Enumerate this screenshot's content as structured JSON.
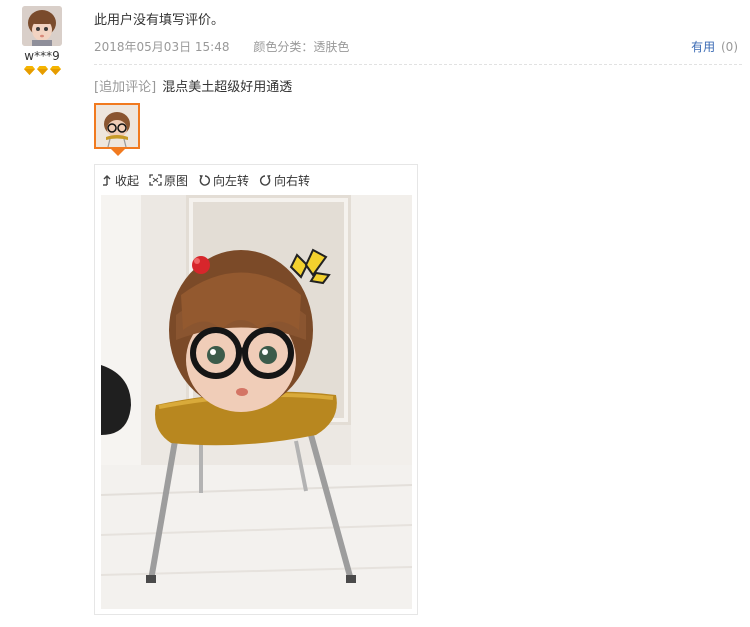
{
  "user": {
    "name": "w***9",
    "level_diamonds": 3
  },
  "review": {
    "text": "此用户没有填写评价。",
    "date": "2018年05月03日 15:48",
    "sku": "颜色分类：透肤色",
    "useful_label": "有用",
    "useful_count": "(0)"
  },
  "append": {
    "tag": "[追加评论]",
    "text": "混点美土超级好用通透"
  },
  "viewer": {
    "collapse_label": "收起",
    "original_label": "原图",
    "rotate_left_label": "向左转",
    "rotate_right_label": "向右转"
  },
  "colors": {
    "accent": "#f17a1f",
    "link": "#3c6cb5",
    "diamond": "#f5b400"
  }
}
